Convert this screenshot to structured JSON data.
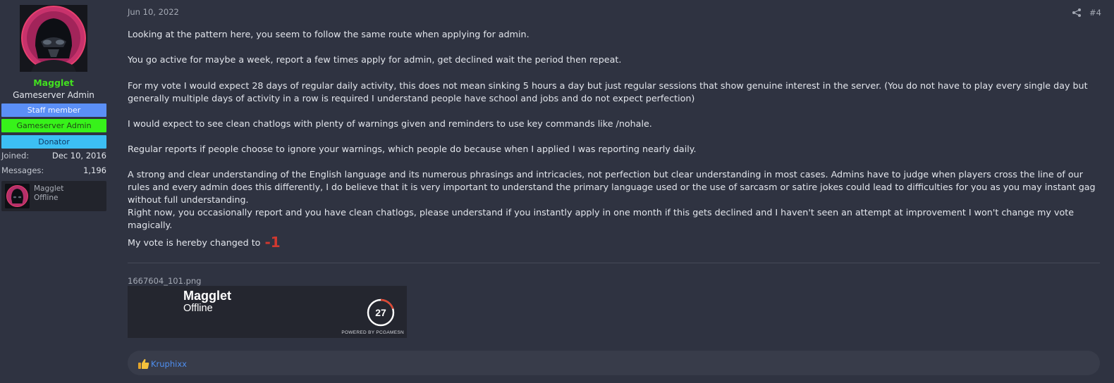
{
  "user": {
    "name": "Magglet",
    "title": "Gameserver Admin",
    "banners": [
      "Staff member",
      "Gameserver Admin",
      "Donator"
    ],
    "joined_label": "Joined:",
    "joined_value": "Dec 10, 2016",
    "messages_label": "Messages:",
    "messages_value": "1,196",
    "mini_name": "Magglet",
    "mini_status": "Offline"
  },
  "post": {
    "date": "Jun 10, 2022",
    "number": "#4",
    "paragraphs": [
      "Looking at the pattern here, you seem to follow the same route when applying for admin.",
      "You go active for maybe a week, report a few times apply for admin, get declined wait the period then repeat.",
      "For my vote I would expect 28 days of regular daily activity, this does not mean sinking 5 hours a day but just regular sessions that show genuine interest in the server. (You do not have to play every single day but generally multiple days of activity in a row is required I understand people have school and jobs and do not expect perfection)",
      "I would expect to see clean chatlogs with plenty of warnings given and reminders to use key commands like /nohale.",
      "Regular reports if people choose to ignore your warnings, which people do because when I applied I was reporting nearly daily.",
      "A strong and clear understanding of the English language and its numerous phrasings and intricacies, not perfection but clear understanding in most cases. Admins have to judge when players cross the line of our rules and every admin does this differently, I do believe that it is very important to understand the primary language used or the use of sarcasm or satire jokes could lead to difficulties for you as you may instant gag without full understanding.",
      "Right now, you occasionally report and you have clean chatlogs, please understand if you instantly apply in one month if this gets declined and I haven't seen an attempt at improvement I won't change my vote magically."
    ],
    "vote_text": "My vote is hereby changed to",
    "vote_value": "-1",
    "attachment_name": "1667604_101.png",
    "steam_card": {
      "name": "Magglet",
      "status": "Offline",
      "level": "27",
      "powered": "POWERED BY PCGAMESN"
    },
    "reactions": {
      "reactor": "Kruphixx"
    }
  },
  "colors": {
    "background": "#2f3341",
    "username": "#42e01f",
    "staff_banner": "#5b8ff6",
    "gameserver_banner": "#37f21a",
    "donator_banner": "#3cbff4",
    "vote_red": "#d1392f",
    "link_blue": "#4f8ff0"
  },
  "icons": {
    "share": "share-icon",
    "like": "thumbs-up-icon",
    "level_ring": "steam-level-ring"
  }
}
